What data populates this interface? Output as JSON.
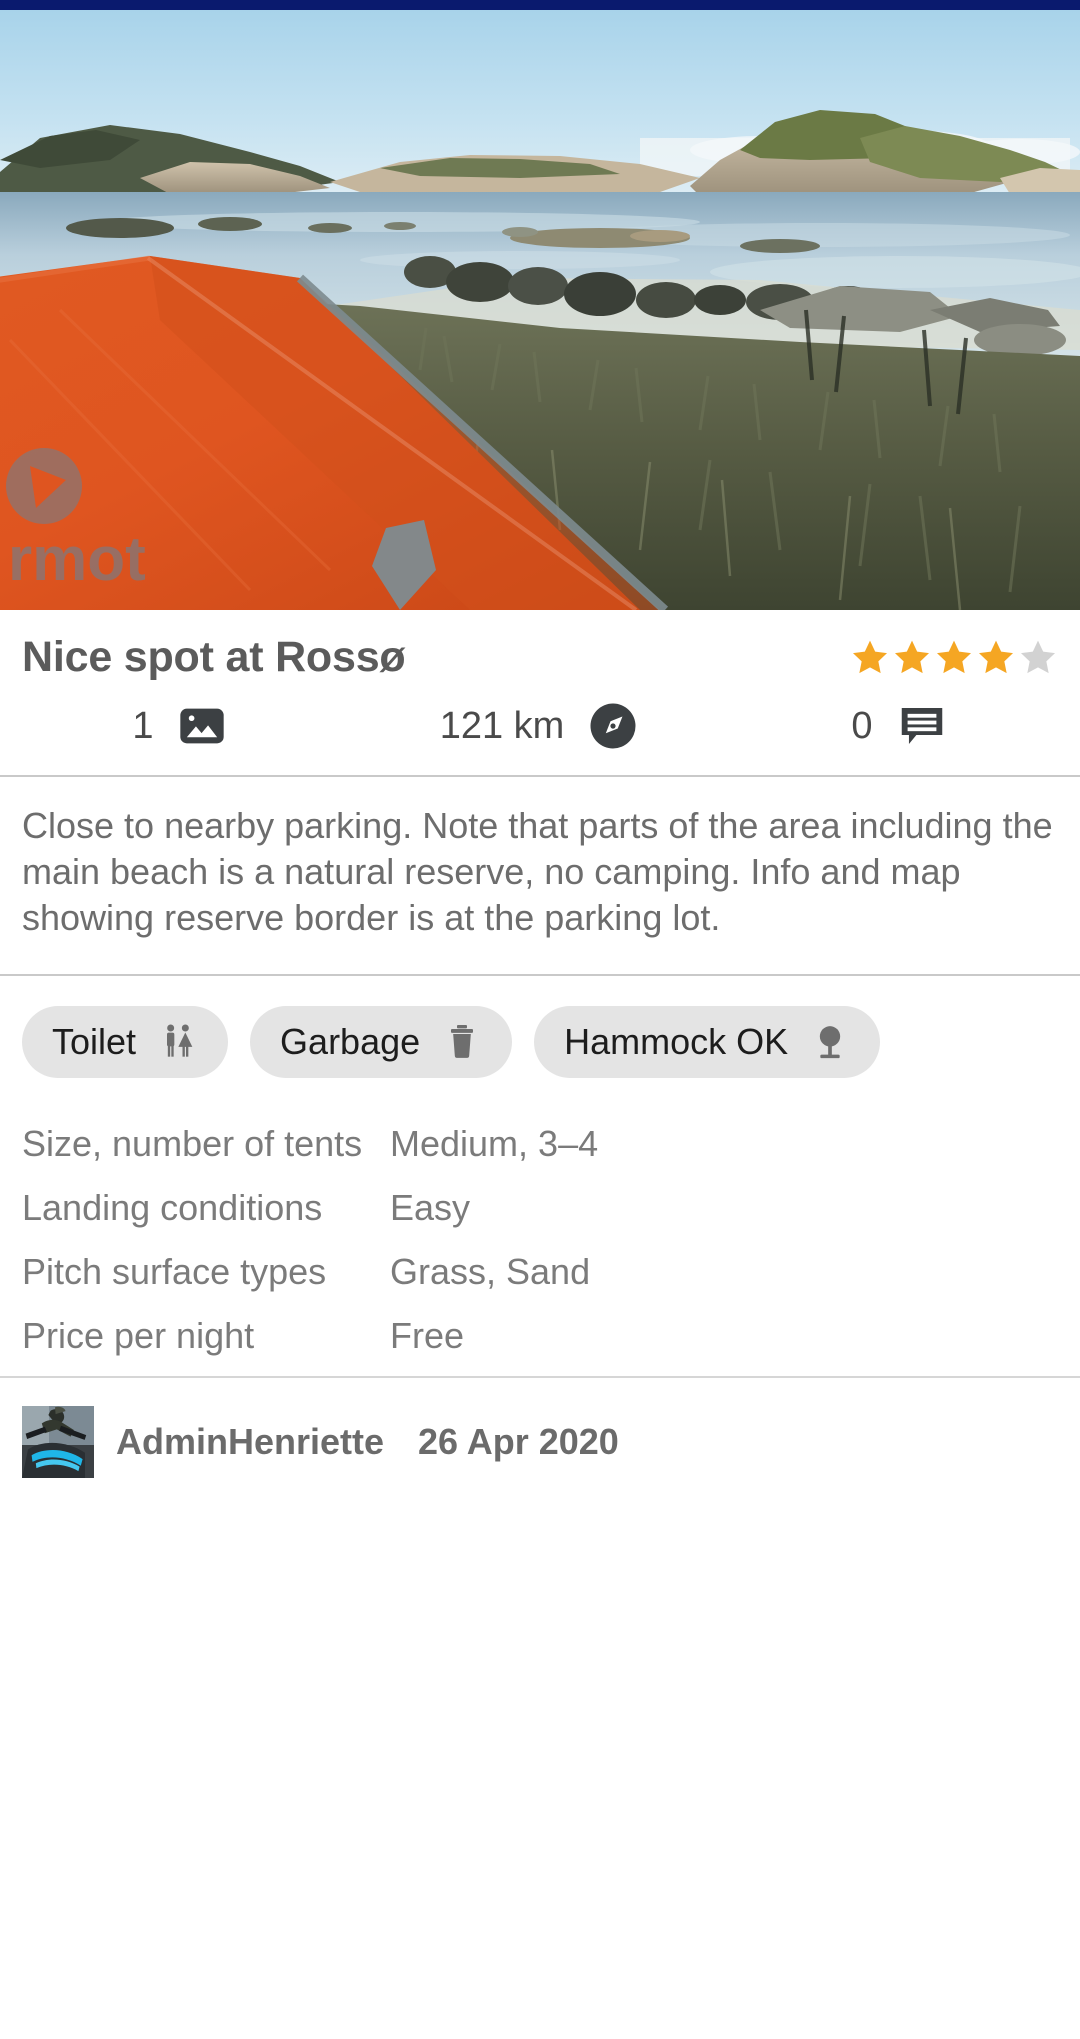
{
  "status_bar": {
    "color": "#0a1a6e"
  },
  "photo": {
    "alt": "Orange Marmot tent pitched on grassy rocky shore beside calm sea at dusk",
    "brand_watermark": "rmot",
    "icon": "photo-hero"
  },
  "listing": {
    "title": "Nice spot at Rossø",
    "rating": {
      "value": 4,
      "max": 5,
      "filled_color": "#F5A623",
      "empty_color": "#D2D2D2"
    },
    "stats": [
      {
        "name": "photo-count",
        "value": "1",
        "icon": "image-icon"
      },
      {
        "name": "distance",
        "value": "121 km",
        "icon": "compass-icon"
      },
      {
        "name": "comment-count",
        "value": "0",
        "icon": "comment-icon"
      }
    ],
    "description": "Close to nearby parking. Note that parts of the area including the main beach is a natural reserve, no camping. Info and map showing reserve border is at the parking lot."
  },
  "amenities": [
    {
      "label": "Toilet",
      "icon": "restroom-icon"
    },
    {
      "label": "Garbage",
      "icon": "trash-icon"
    },
    {
      "label": "Hammock OK",
      "icon": "tree-icon"
    }
  ],
  "attributes": [
    {
      "key": "Size, number of tents",
      "value": "Medium, 3–4"
    },
    {
      "key": "Landing conditions",
      "value": "Easy"
    },
    {
      "key": "Pitch surface types",
      "value": "Grass, Sand"
    },
    {
      "key": "Price per night",
      "value": "Free"
    }
  ],
  "author": {
    "name": "AdminHenriette",
    "date": "26 Apr 2020",
    "avatar_alt": "Kayaker paddling a blue kayak"
  }
}
